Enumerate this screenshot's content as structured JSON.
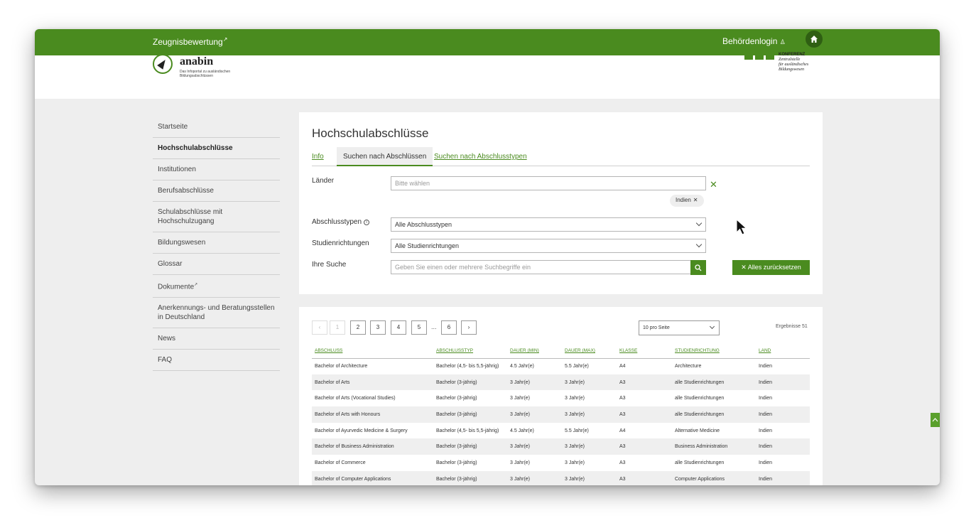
{
  "topbar": {
    "zeugnis_label": "Zeugnisbewertung",
    "login_label": "Behördenlogin"
  },
  "logo": {
    "name": "anabin",
    "tagline": "Das Infoportal zu ausländischen Bildungsabschlüssen"
  },
  "kmk": {
    "line1": "KONFERENZ",
    "line2": "Zentralstelle",
    "line3": "für ausländisches",
    "line4": "Bildungswesen"
  },
  "sidebar": {
    "items": [
      {
        "label": "Startseite"
      },
      {
        "label": "Hochschulabschlüsse"
      },
      {
        "label": "Institutionen"
      },
      {
        "label": "Berufsabschlüsse"
      },
      {
        "label": "Schulabschlüsse mit Hochschulzugang"
      },
      {
        "label": "Bildungswesen"
      },
      {
        "label": "Glossar"
      },
      {
        "label": "Dokumente"
      },
      {
        "label": "Anerkennungs- und Beratungsstellen in Deutschland"
      },
      {
        "label": "News"
      },
      {
        "label": "FAQ"
      }
    ]
  },
  "main": {
    "title": "Hochschulabschlüsse",
    "tabs": [
      {
        "label": "Info"
      },
      {
        "label": "Suchen nach Abschlüssen"
      },
      {
        "label": "Suchen nach Abschlusstypen"
      }
    ],
    "filters": {
      "laender_label": "Länder",
      "laender_placeholder": "Bitte wählen",
      "laender_chip": "Indien",
      "abschlusstypen_label": "Abschlusstypen",
      "abschlusstypen_value": "Alle Abschlusstypen",
      "studienrichtungen_label": "Studienrichtungen",
      "studienrichtungen_value": "Alle Studienrichtungen",
      "suche_label": "Ihre Suche",
      "suche_placeholder": "Geben Sie einen oder mehrere Suchbegriffe ein",
      "reset_label": "Alles zurücksetzen"
    }
  },
  "results": {
    "pages": [
      "1",
      "2",
      "3",
      "4",
      "5",
      "6"
    ],
    "ellipsis": "...",
    "per_page": "10 pro Seite",
    "count_text": "Ergebnisse 51",
    "columns": [
      "ABSCHLUSS",
      "ABSCHLUSSTYP",
      "DAUER (MIN)",
      "DAUER (MAX)",
      "KLASSE",
      "STUDIENRICHTUNG",
      "LAND"
    ],
    "rows": [
      [
        "Bachelor of Architecture",
        "Bachelor (4,5- bis 5,5-jährig)",
        "4.5 Jahr(e)",
        "5.5 Jahr(e)",
        "A4",
        "Architecture",
        "Indien"
      ],
      [
        "Bachelor of Arts",
        "Bachelor (3-jährig)",
        "3 Jahr(e)",
        "3 Jahr(e)",
        "A3",
        "alle Studienrichtungen",
        "Indien"
      ],
      [
        "Bachelor of Arts (Vocational Studies)",
        "Bachelor (3-jährig)",
        "3 Jahr(e)",
        "3 Jahr(e)",
        "A3",
        "alle Studienrichtungen",
        "Indien"
      ],
      [
        "Bachelor of Arts with Honours",
        "Bachelor (3-jährig)",
        "3 Jahr(e)",
        "3 Jahr(e)",
        "A3",
        "alle Studienrichtungen",
        "Indien"
      ],
      [
        "Bachelor of Ayurvedic Medicine & Surgery",
        "Bachelor (4,5- bis 5,5-jährig)",
        "4.5 Jahr(e)",
        "5.5 Jahr(e)",
        "A4",
        "Alternative Medicine",
        "Indien"
      ],
      [
        "Bachelor of Business Administration",
        "Bachelor (3-jährig)",
        "3 Jahr(e)",
        "3 Jahr(e)",
        "A3",
        "Business Administration",
        "Indien"
      ],
      [
        "Bachelor of Commerce",
        "Bachelor (3-jährig)",
        "3 Jahr(e)",
        "3 Jahr(e)",
        "A3",
        "alle Studienrichtungen",
        "Indien"
      ],
      [
        "Bachelor of Computer Applications",
        "Bachelor (3-jährig)",
        "3 Jahr(e)",
        "3 Jahr(e)",
        "A3",
        "Computer Applications",
        "Indien"
      ]
    ]
  }
}
